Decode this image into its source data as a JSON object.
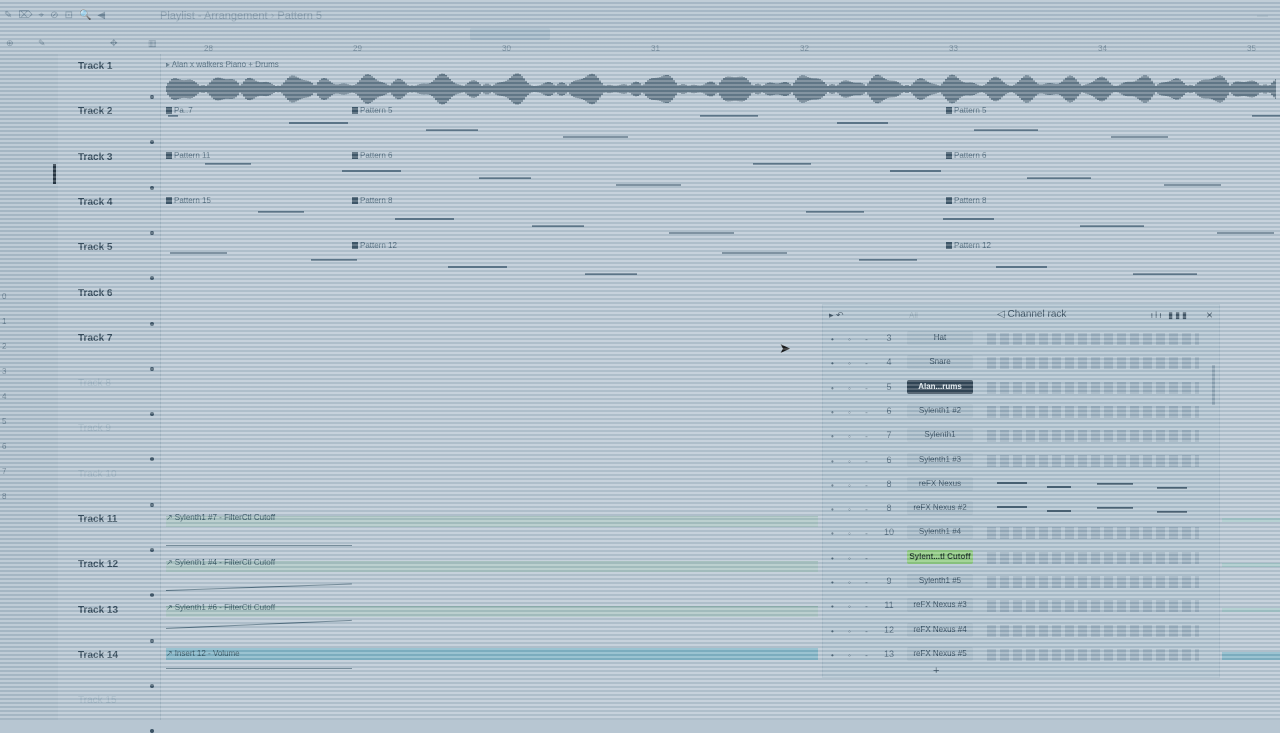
{
  "window": {
    "title": "Playlist - Arrangement",
    "subtitle": "Pattern 5",
    "tools": [
      "✎",
      "⌦",
      "⌖",
      "⊘",
      "⊡",
      "🔍",
      "◀"
    ]
  },
  "ruler": {
    "bars": [
      "28",
      "29",
      "30",
      "31",
      "32",
      "33",
      "34",
      "35"
    ]
  },
  "left_strip": {
    "numbers": [
      "0",
      "1",
      "2",
      "3",
      "4",
      "5",
      "6",
      "7",
      "8"
    ]
  },
  "tracks": [
    {
      "label": "Track 1",
      "dim": false
    },
    {
      "label": "Track 2",
      "dim": false
    },
    {
      "label": "Track 3",
      "dim": false
    },
    {
      "label": "Track 4",
      "dim": false
    },
    {
      "label": "Track 5",
      "dim": false
    },
    {
      "label": "Track 6",
      "dim": false
    },
    {
      "label": "Track 7",
      "dim": false
    },
    {
      "label": "Track 8",
      "dim": true
    },
    {
      "label": "Track 9",
      "dim": true
    },
    {
      "label": "Track 10",
      "dim": true
    },
    {
      "label": "Track 11",
      "dim": false
    },
    {
      "label": "Track 12",
      "dim": false
    },
    {
      "label": "Track 13",
      "dim": false
    },
    {
      "label": "Track 14",
      "dim": false
    },
    {
      "label": "Track 15",
      "dim": true
    }
  ],
  "clips": {
    "audio_track1": "Alan x walkers Piano + Drums",
    "t2_a": "Pa..7",
    "t2_b": "Pattern 5",
    "t2_c": "Pattern 5",
    "t3_a": "Pattern 11",
    "t3_b": "Pattern 6",
    "t3_c": "Pattern 6",
    "t4_a": "Pattern 15",
    "t4_b": "Pattern 8",
    "t4_c": "Pattern 8",
    "t5_b": "Pattern 12",
    "t5_c": "Pattern 12",
    "auto11": "Sylenth1 #7 - FilterCtl Cutoff",
    "auto12": "Sylenth1 #4 - FilterCtl Cutoff",
    "auto13": "Sylenth1 #6 - FilterCtl Cutoff",
    "auto14": "Insert 12 - Volume"
  },
  "channel_rack": {
    "title": "Channel rack",
    "filter": "All",
    "close": "×",
    "icons": "ılı ▮▮▮",
    "channels": [
      {
        "num": "3",
        "name": "Hat",
        "style": "normal",
        "kind": "steps"
      },
      {
        "num": "4",
        "name": "Snare",
        "style": "normal",
        "kind": "steps"
      },
      {
        "num": "5",
        "name": "Alan...rums",
        "style": "sel",
        "kind": "steps"
      },
      {
        "num": "6",
        "name": "Sylenth1 #2",
        "style": "normal",
        "kind": "steps"
      },
      {
        "num": "7",
        "name": "Sylenth1",
        "style": "normal",
        "kind": "steps"
      },
      {
        "num": "6",
        "name": "Sylenth1 #3",
        "style": "normal",
        "kind": "steps"
      },
      {
        "num": "8",
        "name": "reFX Nexus",
        "style": "normal",
        "kind": "roll"
      },
      {
        "num": "8",
        "name": "reFX Nexus #2",
        "style": "normal",
        "kind": "roll"
      },
      {
        "num": "10",
        "name": "Sylenth1 #4",
        "style": "normal",
        "kind": "steps"
      },
      {
        "num": "",
        "name": "Sylent...tl Cutoff",
        "style": "auto",
        "kind": "steps"
      },
      {
        "num": "9",
        "name": "Sylenth1 #5",
        "style": "normal",
        "kind": "steps"
      },
      {
        "num": "11",
        "name": "reFX Nexus #3",
        "style": "normal",
        "kind": "steps"
      },
      {
        "num": "12",
        "name": "reFX Nexus #4",
        "style": "normal",
        "kind": "steps"
      },
      {
        "num": "13",
        "name": "reFX Nexus #5",
        "style": "normal",
        "kind": "steps"
      }
    ],
    "add_label": "+"
  },
  "colors": {
    "background": "#b7c6d2",
    "automation_green": "#8cc97c",
    "insert_teal": "#7fb2c4",
    "selected_channel": "#2a3e4e"
  }
}
